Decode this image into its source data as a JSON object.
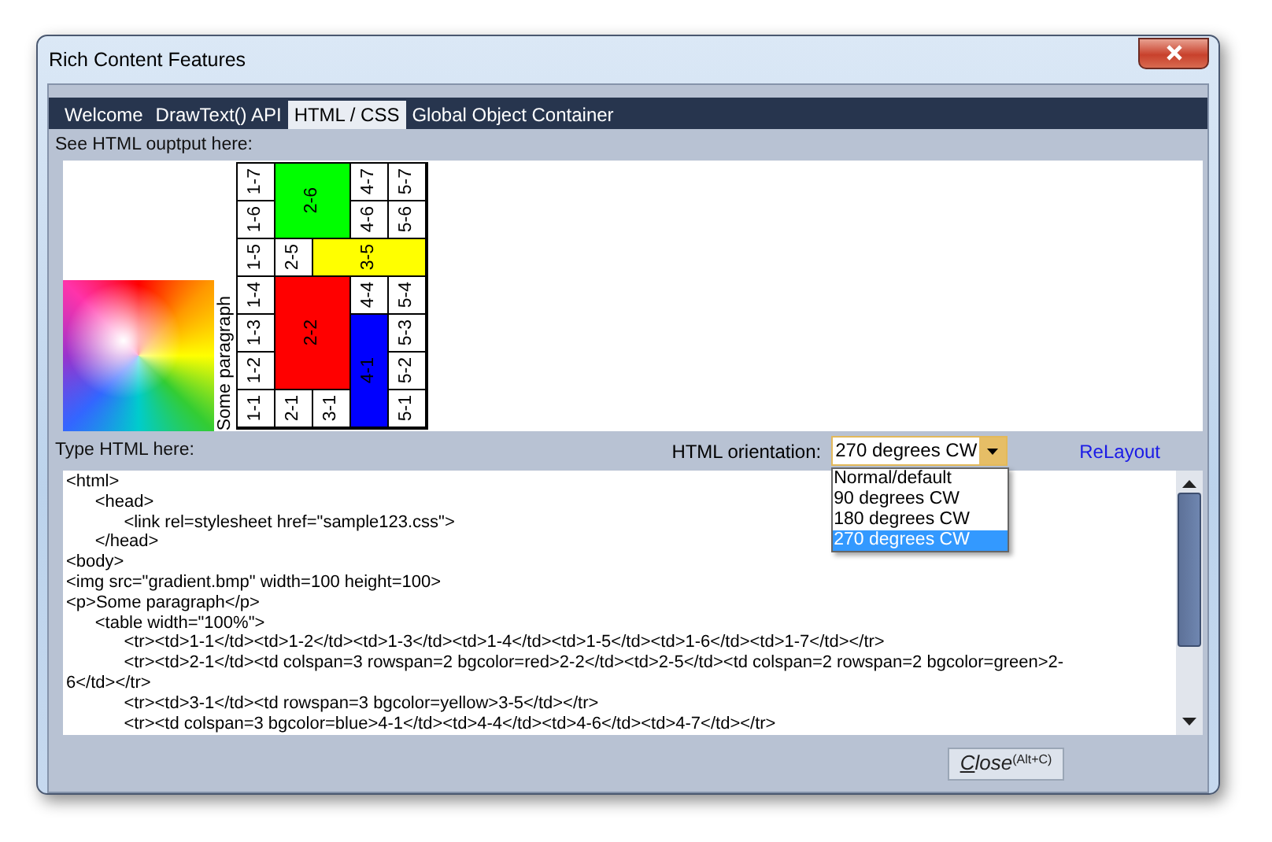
{
  "window": {
    "title": "Rich Content Features"
  },
  "tabs": [
    {
      "label": "Welcome",
      "selected": false
    },
    {
      "label": "DrawText() API",
      "selected": false
    },
    {
      "label": "HTML / CSS",
      "selected": true
    },
    {
      "label": "Global Object Container",
      "selected": false
    }
  ],
  "preview": {
    "label": "See HTML ouptput here:",
    "paragraph": "Some paragraph",
    "table_rows": [
      [
        {
          "kind": "cell",
          "text": "1-1"
        },
        {
          "kind": "cell",
          "text": "1-2"
        },
        {
          "kind": "cell",
          "text": "1-3"
        },
        {
          "kind": "cell",
          "text": "1-4"
        },
        {
          "kind": "cell",
          "text": "1-5"
        },
        {
          "kind": "cell",
          "text": "1-6"
        },
        {
          "kind": "cell",
          "text": "1-7"
        }
      ],
      [
        {
          "kind": "cell",
          "text": "2-1"
        },
        {
          "kind": "cell",
          "text": "2-2",
          "color": "#ff0000"
        },
        {
          "kind": "left"
        },
        {
          "kind": "left"
        },
        {
          "kind": "cell",
          "text": "2-5"
        },
        {
          "kind": "cell",
          "text": "2-6",
          "color": "#00ff00"
        },
        {
          "kind": "left"
        }
      ],
      [
        {
          "kind": "cell",
          "text": "3-1"
        },
        {
          "kind": "up"
        },
        {
          "kind": "up"
        },
        {
          "kind": "up"
        },
        {
          "kind": "cell",
          "text": "3-5",
          "color": "#ffff00"
        },
        {
          "kind": "up"
        },
        {
          "kind": "up"
        }
      ],
      [
        {
          "kind": "cell",
          "text": "4-1",
          "color": "#0000ff"
        },
        {
          "kind": "left"
        },
        {
          "kind": "left"
        },
        {
          "kind": "cell",
          "text": "4-4"
        },
        {
          "kind": "up"
        },
        {
          "kind": "cell",
          "text": "4-6"
        },
        {
          "kind": "cell",
          "text": "4-7"
        }
      ],
      [
        {
          "kind": "cell",
          "text": "5-1"
        },
        {
          "kind": "cell",
          "text": "5-2"
        },
        {
          "kind": "cell",
          "text": "5-3"
        },
        {
          "kind": "cell",
          "text": "5-4"
        },
        {
          "kind": "up"
        },
        {
          "kind": "cell",
          "text": "5-6"
        },
        {
          "kind": "cell",
          "text": "5-7"
        }
      ]
    ]
  },
  "editor": {
    "label": "Type HTML here:",
    "lines": [
      "<html>",
      "\t<head>",
      "\t\t<link rel=stylesheet href=\"sample123.css\">",
      "\t</head>",
      "<body>",
      "<img src=\"gradient.bmp\" width=100 height=100>",
      "<p>Some paragraph</p>",
      "\t<table width=\"100%\">",
      "\t\t<tr><td>1-1</td><td>1-2</td><td>1-3</td><td>1-4</td><td>1-5</td><td>1-6</td><td>1-7</td></tr>",
      "\t\t<tr><td>2-1</td><td colspan=3 rowspan=2 bgcolor=red>2-2</td><td>2-5</td><td colspan=2 rowspan=2 bgcolor=green>2-",
      "6</td></tr>",
      "\t\t<tr><td>3-1</td><td rowspan=3 bgcolor=yellow>3-5</td></tr>",
      "\t\t<tr><td colspan=3 bgcolor=blue>4-1</td><td>4-4</td><td>4-6</td><td>4-7</td></tr>"
    ]
  },
  "orientation": {
    "label": "HTML orientation:",
    "value": "270 degrees CW",
    "expanded": true,
    "options": [
      {
        "label": "Normal/default",
        "selected": false
      },
      {
        "label": "90 degrees CW",
        "selected": false
      },
      {
        "label": "180 degrees CW",
        "selected": false
      },
      {
        "label": "270 degrees CW",
        "selected": true
      }
    ]
  },
  "relayout_link": "ReLayout",
  "close_button": {
    "label": "Close",
    "shortcut": "(Alt+C)"
  }
}
